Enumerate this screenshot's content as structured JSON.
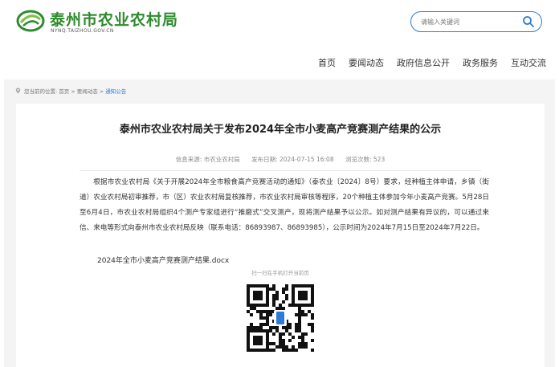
{
  "header": {
    "site_title": "泰州市农业农村局",
    "site_domain": "NYNQ.TAIZHOU.GOV.CN",
    "search_placeholder": "请输入关键词"
  },
  "nav": {
    "items": [
      "首页",
      "要闻动态",
      "政府信息公开",
      "政务服务",
      "互动交流"
    ]
  },
  "breadcrumb": {
    "label": "您当前的位置:",
    "items": [
      "首页 >",
      "要闻动态 >",
      "通知公告"
    ]
  },
  "article": {
    "title": "泰州市农业农村局关于发布2024年全市小麦高产竞赛测产结果的公示",
    "meta": {
      "source": "信息来源: 市农业农村局",
      "date": "发布日期: 2024-07-15 16:08",
      "views": "浏览次数: 523"
    },
    "body": "根据市农业农村局《关于开展2024年全市粮食高产竞赛活动的通知》（泰农业〔2024〕8号）要求，经种植主体申请，乡镇（街道）农业农村局初审推荐，市（区）农业农村局复核推荐，市农业农村局审核等程序，20个种植主体参加今年小麦高产竞赛。5月28日至6月4日，市农业农村局组织4个测产专家组进行“推磨式”交叉测产，现将测产结果予以公示。如对测产结果有异议的，可以通过来信、来电等形式向泰州市农业农村局反映（联系电话：86893987、86893985），公示时间为2024年7月15日至2024年7月22日。",
    "attachment": "2024年全市小麦高产竞赛测产结果.docx",
    "qr_label": "扫一扫在手机打开当前页"
  },
  "colors": {
    "brand_green": "#2e8b2e",
    "accent_blue": "#2e7bd6"
  }
}
